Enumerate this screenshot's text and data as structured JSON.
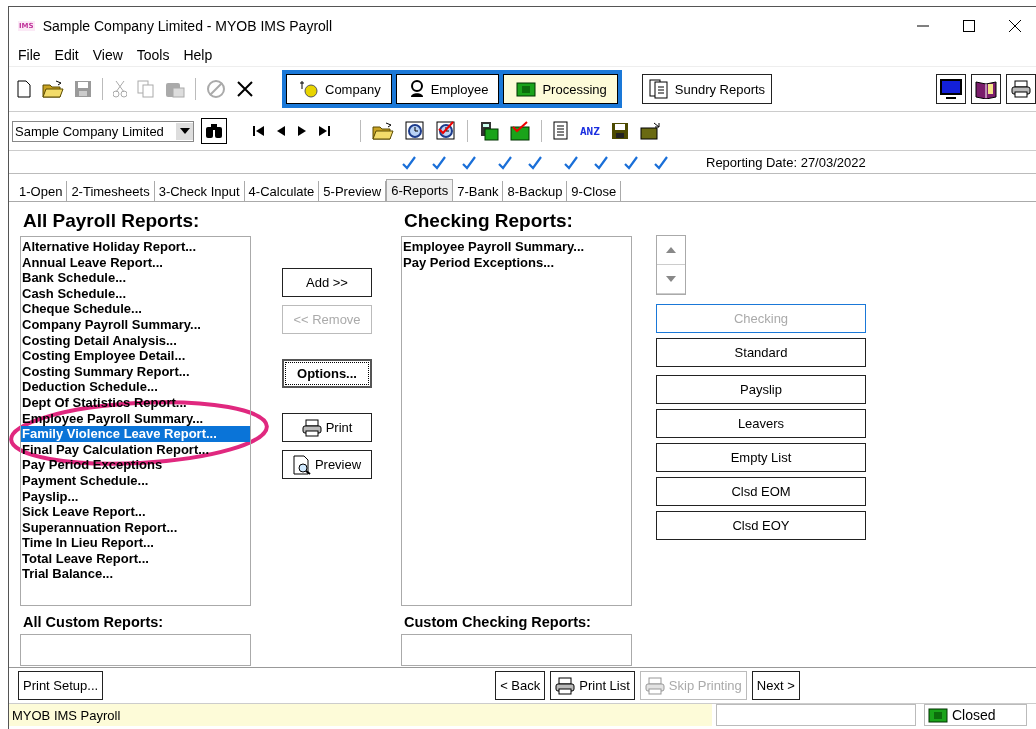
{
  "window": {
    "logo": "IMS",
    "title": "Sample Company Limited - MYOB IMS Payroll"
  },
  "menu": [
    "File",
    "Edit",
    "View",
    "Tools",
    "Help"
  ],
  "modules": [
    {
      "label": "Company",
      "selected": false
    },
    {
      "label": "Employee",
      "selected": false
    },
    {
      "label": "Processing",
      "selected": true
    }
  ],
  "sundry_button": "Sundry Reports",
  "company_select": "Sample Company Limited",
  "bank_label": "ANZ",
  "steps": [
    {
      "checked": true
    },
    {
      "checked": true
    },
    {
      "checked": true
    },
    {
      "checked": true
    },
    {
      "checked": true
    },
    {
      "checked": true
    },
    {
      "checked": true
    },
    {
      "checked": true
    },
    {
      "checked": true
    }
  ],
  "reporting_date": "Reporting Date: 27/03/2022",
  "tabs": [
    {
      "label": "1-Open",
      "selected": false
    },
    {
      "label": "2-Timesheets",
      "selected": false
    },
    {
      "label": "3-Check Input",
      "selected": false
    },
    {
      "label": "4-Calculate",
      "selected": false
    },
    {
      "label": "5-Preview",
      "selected": false
    },
    {
      "label": "6-Reports",
      "selected": true
    },
    {
      "label": "7-Bank",
      "selected": false
    },
    {
      "label": "8-Backup",
      "selected": false
    },
    {
      "label": "9-Close",
      "selected": false
    }
  ],
  "all_reports": {
    "heading": "All Payroll Reports:",
    "items": [
      {
        "label": "Alternative Holiday Report...",
        "selected": false
      },
      {
        "label": "Annual Leave Report...",
        "selected": false
      },
      {
        "label": "Bank Schedule...",
        "selected": false
      },
      {
        "label": "Cash Schedule...",
        "selected": false
      },
      {
        "label": "Cheque Schedule...",
        "selected": false
      },
      {
        "label": "Company Payroll Summary...",
        "selected": false
      },
      {
        "label": "Costing Detail Analysis...",
        "selected": false
      },
      {
        "label": "Costing Employee Detail...",
        "selected": false
      },
      {
        "label": "Costing Summary Report...",
        "selected": false
      },
      {
        "label": "Deduction Schedule...",
        "selected": false
      },
      {
        "label": "Dept Of Statistics Report...",
        "selected": false
      },
      {
        "label": "Employee Payroll Summary...",
        "selected": false
      },
      {
        "label": "Family Violence Leave Report...",
        "selected": true
      },
      {
        "label": "Final Pay Calculation Report...",
        "selected": false
      },
      {
        "label": "Pay Period Exceptions",
        "selected": false
      },
      {
        "label": "Payment Schedule...",
        "selected": false
      },
      {
        "label": "Payslip...",
        "selected": false
      },
      {
        "label": "Sick Leave Report...",
        "selected": false
      },
      {
        "label": "Superannuation Report...",
        "selected": false
      },
      {
        "label": "Time In Lieu Report...",
        "selected": false
      },
      {
        "label": "Total Leave Report...",
        "selected": false
      },
      {
        "label": "Trial Balance...",
        "selected": false
      }
    ]
  },
  "middle_buttons": [
    {
      "label": "Add >>",
      "kind": "plain",
      "disabled": false
    },
    {
      "label": "<< Remove",
      "kind": "plain",
      "disabled": true
    },
    {
      "label": "Options...",
      "kind": "default",
      "disabled": false
    },
    {
      "label": "Print",
      "kind": "print",
      "disabled": false
    },
    {
      "label": "Preview",
      "kind": "preview",
      "disabled": false
    }
  ],
  "checking_reports": {
    "heading": "Checking Reports:",
    "items": [
      {
        "label": "Employee Payroll Summary...",
        "selected": false
      },
      {
        "label": "Pay Period Exceptions...",
        "selected": false
      }
    ]
  },
  "filters": [
    {
      "label": "Checking",
      "selected": true
    },
    {
      "label": "Standard",
      "selected": false
    },
    {
      "label": "Payslip",
      "selected": false
    },
    {
      "label": "Leavers",
      "selected": false
    },
    {
      "label": "Empty List",
      "selected": false
    },
    {
      "label": "Clsd EOM",
      "selected": false
    },
    {
      "label": "Clsd EOY",
      "selected": false
    }
  ],
  "custom_headings": [
    "All Custom Reports:",
    "Custom Checking Reports:"
  ],
  "bottom_buttons": [
    {
      "label": "Print Setup...",
      "kind": "plain",
      "disabled": false
    },
    {
      "label": "< Back",
      "kind": "plain",
      "disabled": false
    },
    {
      "label": "Print List",
      "kind": "print",
      "disabled": false
    },
    {
      "label": "Skip Printing",
      "kind": "print",
      "disabled": true
    },
    {
      "label": "Next >",
      "kind": "plain",
      "disabled": false
    }
  ],
  "status_bar": {
    "text": "MYOB IMS Payroll",
    "state": "Closed"
  }
}
